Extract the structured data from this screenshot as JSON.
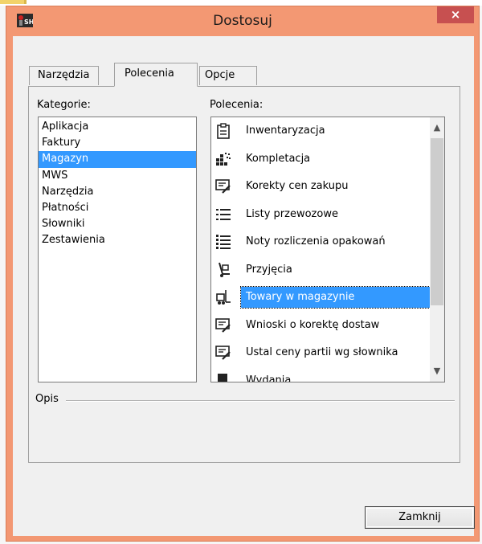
{
  "window": {
    "title": "Dostosuj",
    "close_glyph": "×"
  },
  "tabs": [
    {
      "label": "Narzędzia"
    },
    {
      "label": "Polecenia"
    },
    {
      "label": "Opcje"
    }
  ],
  "categories": {
    "label": "Kategorie:",
    "items": [
      "Aplikacja",
      "Faktury",
      "Magazyn",
      "MWS",
      "Narzędzia",
      "Płatności",
      "Słowniki",
      "Zestawienia"
    ],
    "selected": "Magazyn"
  },
  "commands": {
    "label": "Polecenia:",
    "items": [
      {
        "label": "Inwentaryzacja",
        "icon": "clipboard-icon"
      },
      {
        "label": "Kompletacja",
        "icon": "grid-dots-icon"
      },
      {
        "label": "Korekty cen zakupu",
        "icon": "edit-form-icon"
      },
      {
        "label": "Listy przewozowe",
        "icon": "list-icon"
      },
      {
        "label": "Noty rozliczenia opakowań",
        "icon": "list-bullets-icon"
      },
      {
        "label": "Przyjęcia",
        "icon": "hand-truck-icon"
      },
      {
        "label": "Towary w magazynie",
        "icon": "forklift-icon"
      },
      {
        "label": "Wnioski o korektę dostaw",
        "icon": "edit-form-icon"
      },
      {
        "label": "Ustal ceny partii wg słownika",
        "icon": "edit-form-icon"
      },
      {
        "label": "Wydania",
        "icon": "outgoing-box-icon"
      }
    ],
    "selected": "Towary w magazynie"
  },
  "description": {
    "label": "Opis"
  },
  "footer": {
    "close_label": "Zamknij"
  },
  "colors": {
    "title_bar": "#f39873",
    "close_button": "#c75050",
    "selection": "#3399ff"
  }
}
